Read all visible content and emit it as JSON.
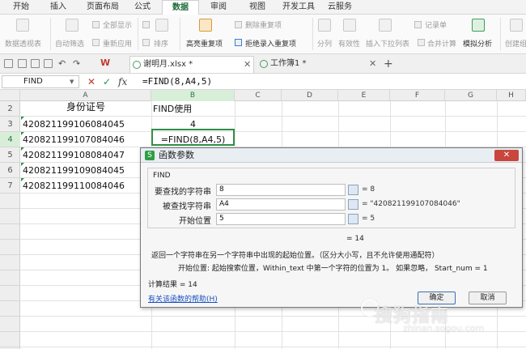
{
  "menu": [
    "开始",
    "插入",
    "页面布局",
    "公式",
    "数据",
    "审阅",
    "视图",
    "开发工具",
    "云服务"
  ],
  "menu_active": "数据",
  "ribbon": {
    "pivot": "数据透视表",
    "autofilter": "自动筛选",
    "showall": "全部显示",
    "reapply": "重新应用",
    "sort": "排序",
    "highlight_dup": "高亮重复项",
    "delete_dup": "删除重复项",
    "reject_dup": "拒绝录入重复项",
    "split": "分列",
    "validity": "有效性",
    "dropdown": "插入下拉列表",
    "consolidate": "合并计算",
    "record": "记录单",
    "simulate": "模拟分析",
    "group": "创建组"
  },
  "tabs": [
    {
      "label": "谢明月.xlsx *"
    },
    {
      "label": "工作簿1 *"
    }
  ],
  "formula_bar": {
    "name_box": "FIND",
    "cancel_icon": "✕",
    "confirm_icon": "✓",
    "fx": "fx",
    "formula": "=FIND(8,A4,5)"
  },
  "columns": [
    "A",
    "B",
    "C",
    "D",
    "E",
    "F",
    "G",
    "H"
  ],
  "rows": [
    "2",
    "3",
    "4",
    "5",
    "6",
    "7"
  ],
  "cells": {
    "a2": "身份证号",
    "b2": "FIND使用",
    "a3": "420821199106084045",
    "b3": "4",
    "a4": "420821199107084046",
    "b4": "=FIND(8,A4,5)",
    "a5": "420821199108084047",
    "a6": "420821199109084045",
    "a7": "420821199110084046"
  },
  "dialog": {
    "title": "函数参数",
    "close": "✕",
    "function_name": "FIND",
    "args": [
      {
        "label": "要查找的字符串",
        "value": "8",
        "result": "= 8"
      },
      {
        "label": "被查找字符串",
        "value": "A4",
        "result": "= \"420821199107084046\""
      },
      {
        "label": "开始位置",
        "value": "5",
        "result": "= 5"
      }
    ],
    "total": "= 14",
    "description": "返回一个字符串在另一个字符串中出现的起始位置。（区分大小写，且不允许使用通配符）",
    "arg_help": "开始位置:  起始搜索位置，Within_text 中第一个字符的位置为 1。 如果忽略， Start_num = 1",
    "calc_result": "计算结果 = 14",
    "help_link": "有关该函数的帮助(H)",
    "ok": "确定",
    "cancel": "取消"
  },
  "watermark": {
    "text": "搜狗指南",
    "sub": "zhinan.sogou.com"
  }
}
